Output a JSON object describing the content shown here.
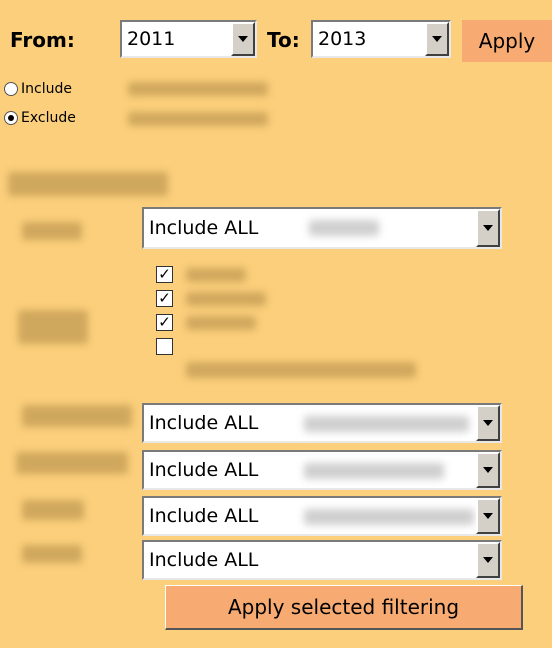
{
  "header": {
    "from_label": "From:",
    "from_value": "2011",
    "to_label": "To:",
    "to_value": "2013",
    "apply_label": "Apply"
  },
  "mode_options": [
    {
      "label": "Include",
      "checked": false
    },
    {
      "label": "Exclude",
      "checked": true
    }
  ],
  "filters": {
    "select_1": "Include ALL",
    "checkboxes": [
      {
        "checked": true,
        "mark": "✓"
      },
      {
        "checked": true,
        "mark": "✓"
      },
      {
        "checked": true,
        "mark": "✓"
      },
      {
        "checked": false,
        "mark": ""
      }
    ],
    "select_2": "Include ALL",
    "select_3": "Include ALL",
    "select_4": "Include ALL",
    "select_5": "Include ALL",
    "apply_selected_label": "Apply selected filtering"
  },
  "colors": {
    "panel_background": "#fbcf7b",
    "button_background": "#f7ab72"
  }
}
